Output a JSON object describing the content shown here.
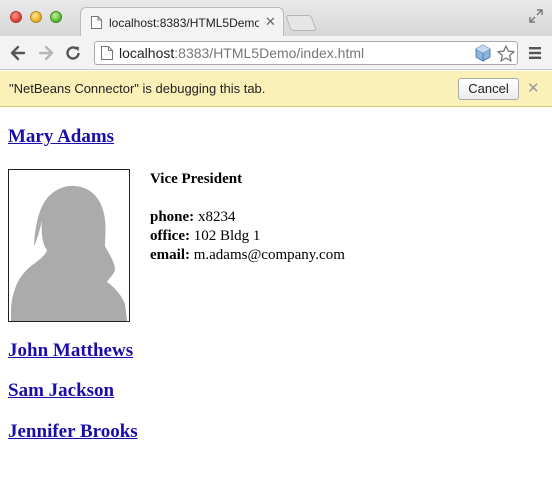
{
  "browser": {
    "tab_title": "localhost:8383/HTML5Demo/index.html",
    "url_host": "localhost",
    "url_rest": ":8383/HTML5Demo/index.html",
    "infobar_text": "\"NetBeans Connector\" is debugging this tab.",
    "cancel_label": "Cancel"
  },
  "page": {
    "selected_person": {
      "name": "Mary Adams",
      "title": "Vice President",
      "phone_label": "phone:",
      "phone": "x8234",
      "office_label": "office:",
      "office": "102 Bldg 1",
      "email_label": "email:",
      "email": "m.adams@company.com"
    },
    "other_people": [
      "John Matthews",
      "Sam Jackson",
      "Jennifer Brooks"
    ]
  }
}
